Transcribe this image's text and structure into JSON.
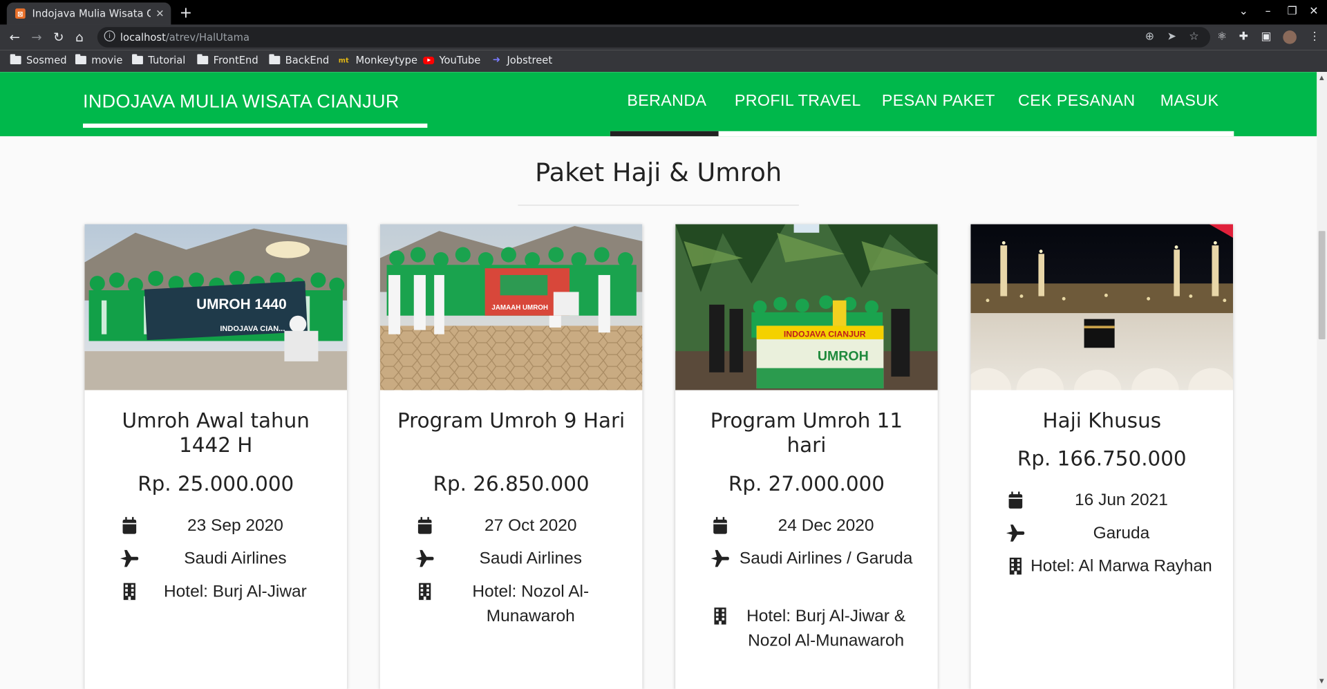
{
  "browser": {
    "tab_title": "Indojava Mulia Wisata Cia",
    "tab_close": "✕",
    "new_tab": "+",
    "url_host": "localhost",
    "url_path": "/atrev/HalUtama",
    "bookmarks": [
      {
        "label": "Sosmed",
        "icon": "folder-icon"
      },
      {
        "label": "movie",
        "icon": "folder-icon"
      },
      {
        "label": "Tutorial",
        "icon": "folder-icon"
      },
      {
        "label": "FrontEnd",
        "icon": "folder-icon"
      },
      {
        "label": "BackEnd",
        "icon": "folder-icon"
      },
      {
        "label": "Monkeytype",
        "icon": "monkeytype-icon"
      },
      {
        "label": "YouTube",
        "icon": "youtube-icon"
      },
      {
        "label": "Jobstreet",
        "icon": "jobstreet-icon"
      }
    ]
  },
  "navbar": {
    "brand": "INDOJAVA MULIA WISATA CIANJUR",
    "menu": [
      "BERANDA",
      "PROFIL TRAVEL",
      "PESAN PAKET",
      "CEK PESANAN",
      "MASUK"
    ],
    "active": "BERANDA",
    "color": "#00b84b"
  },
  "section": {
    "title": "Paket Haji & Umroh"
  },
  "packages": [
    {
      "title": "Umroh Awal tahun 1442 H",
      "price": "Rp. 25.000.000",
      "date": "23 Sep 2020",
      "airline": "Saudi Airlines",
      "hotel": "Hotel: Burj Al-Jiwar",
      "photo_text": "UMROH 1440",
      "photo_subtext": "INDOJAVA CIAN..."
    },
    {
      "title": "Program Umroh 9 Hari",
      "price": "Rp. 26.850.000",
      "date": "27 Oct 2020",
      "airline": "Saudi Airlines",
      "hotel": "Hotel: Nozol Al-Munawaroh",
      "photo_text": "JAMAAH UMROH"
    },
    {
      "title": "Program Umroh 11 hari",
      "price": "Rp. 27.000.000",
      "date": "24 Dec 2020",
      "airline": "Saudi Airlines / Garuda",
      "hotel": "Hotel: Burj Al-Jiwar & Nozol Al-Munawaroh",
      "photo_text": "INDOJAVA CIANJUR",
      "photo_subtext": "UMROH"
    },
    {
      "title": "Haji Khusus",
      "price": "Rp. 166.750.000",
      "date": "16 Jun 2021",
      "airline": "Garuda",
      "hotel": "Hotel: Al Marwa Rayhan"
    }
  ]
}
